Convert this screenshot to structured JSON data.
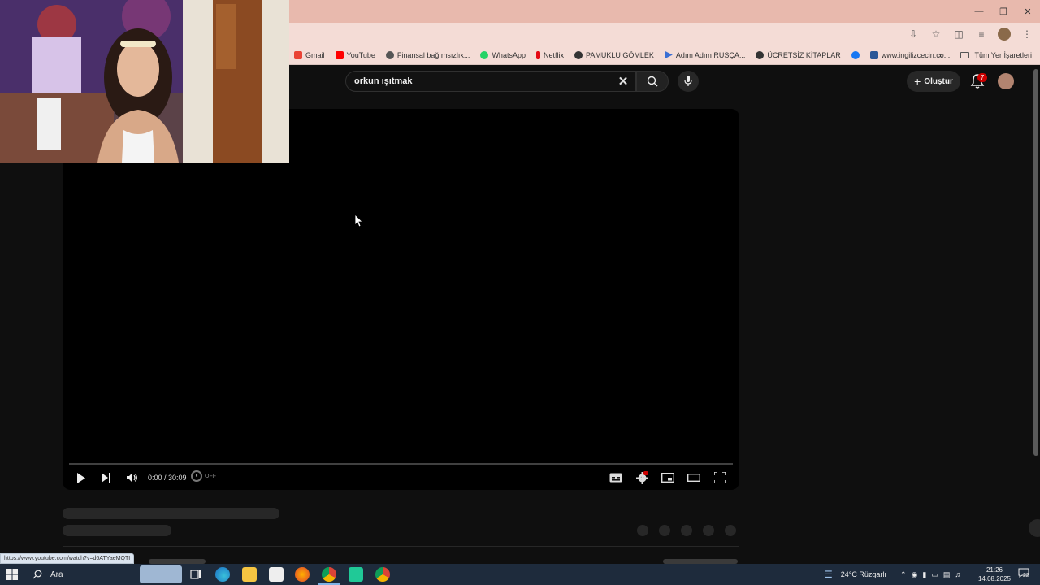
{
  "bookmarks": [
    {
      "label": "Gmail",
      "color": "#ea4335"
    },
    {
      "label": "YouTube",
      "color": "#ff0000"
    },
    {
      "label": "Finansal bağımsızlık...",
      "color": "#555555"
    },
    {
      "label": "WhatsApp",
      "color": "#25d366"
    },
    {
      "label": "Netflix",
      "color": "#e50914"
    },
    {
      "label": "PAMUKLU GÖMLEK",
      "color": "#333333"
    },
    {
      "label": "Adım Adım RUSÇA...",
      "color": "#3b6fd4"
    },
    {
      "label": "ÜCRETSİZ KİTAPLAR",
      "color": "#333333"
    },
    {
      "label": "",
      "color": "#1877f2"
    },
    {
      "label": "www.ingilizcecin.co...",
      "color": "#2b5797"
    }
  ],
  "bookmarks_all": "Tüm Yer İşaretleri",
  "search": {
    "query": "orkun ışıtmak"
  },
  "header": {
    "create_label": "Oluştur",
    "notification_count": "7"
  },
  "player": {
    "time": "0:00 / 30:09",
    "autoplay_state": "OFF",
    "autoplay_glyph": "⏸"
  },
  "status_url": "https://www.youtube.com/watch?v=d6ATYaeMQTI",
  "taskbar": {
    "search_label": "Ara",
    "weather": "24°C  Rüzgarlı",
    "time": "21:26",
    "date": "14.08.2025",
    "notifications": "22"
  }
}
